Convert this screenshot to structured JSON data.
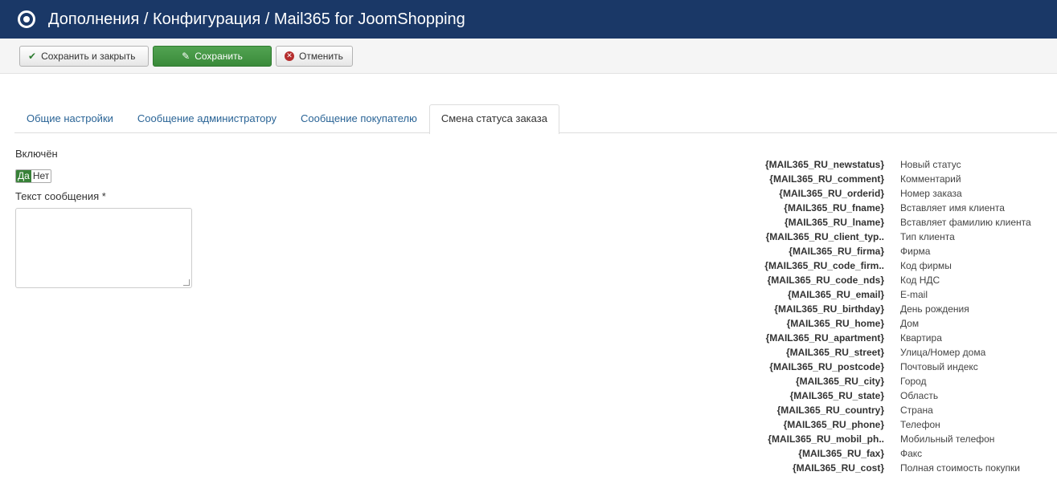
{
  "header": {
    "title": "Дополнения / Конфигурация / Mail365 for JoomShopping",
    "logo_icon": "joomla-target-icon"
  },
  "toolbar": {
    "save_close_label": "Сохранить и закрыть",
    "save_label": "Сохранить",
    "cancel_label": "Отменить"
  },
  "tabs": [
    {
      "label": "Общие настройки",
      "active": false
    },
    {
      "label": "Сообщение администратору",
      "active": false
    },
    {
      "label": "Сообщение покупателю",
      "active": false
    },
    {
      "label": "Смена статуса заказа",
      "active": true
    }
  ],
  "form": {
    "enabled_label": "Включён",
    "yes_label": "Да",
    "no_label": "Нет",
    "selected": "Да",
    "message_label": "Текст сообщения *",
    "message_value": ""
  },
  "variables": [
    {
      "code": "{MAIL365_RU_newstatus}",
      "desc": "Новый статус"
    },
    {
      "code": "{MAIL365_RU_comment}",
      "desc": "Комментарий"
    },
    {
      "code": "{MAIL365_RU_orderid}",
      "desc": "Номер заказа"
    },
    {
      "code": "{MAIL365_RU_fname}",
      "desc": "Вставляет имя клиента"
    },
    {
      "code": "{MAIL365_RU_lname}",
      "desc": "Вставляет фамилию клиента"
    },
    {
      "code": "{MAIL365_RU_client_typ..",
      "desc": "Тип клиента"
    },
    {
      "code": "{MAIL365_RU_firma}",
      "desc": "Фирма"
    },
    {
      "code": "{MAIL365_RU_code_firm..",
      "desc": "Код фирмы"
    },
    {
      "code": "{MAIL365_RU_code_nds}",
      "desc": "Код НДС"
    },
    {
      "code": "{MAIL365_RU_email}",
      "desc": "E-mail"
    },
    {
      "code": "{MAIL365_RU_birthday}",
      "desc": "День рождения"
    },
    {
      "code": "{MAIL365_RU_home}",
      "desc": "Дом"
    },
    {
      "code": "{MAIL365_RU_apartment}",
      "desc": "Квартира"
    },
    {
      "code": "{MAIL365_RU_street}",
      "desc": "Улица/Номер дома"
    },
    {
      "code": "{MAIL365_RU_postcode}",
      "desc": "Почтовый индекс"
    },
    {
      "code": "{MAIL365_RU_city}",
      "desc": "Город"
    },
    {
      "code": "{MAIL365_RU_state}",
      "desc": "Область"
    },
    {
      "code": "{MAIL365_RU_country}",
      "desc": "Страна"
    },
    {
      "code": "{MAIL365_RU_phone}",
      "desc": "Телефон"
    },
    {
      "code": "{MAIL365_RU_mobil_ph..",
      "desc": "Мобильный телефон"
    },
    {
      "code": "{MAIL365_RU_fax}",
      "desc": "Факс"
    },
    {
      "code": "{MAIL365_RU_cost}",
      "desc": "Полная стоимость покупки"
    }
  ]
}
